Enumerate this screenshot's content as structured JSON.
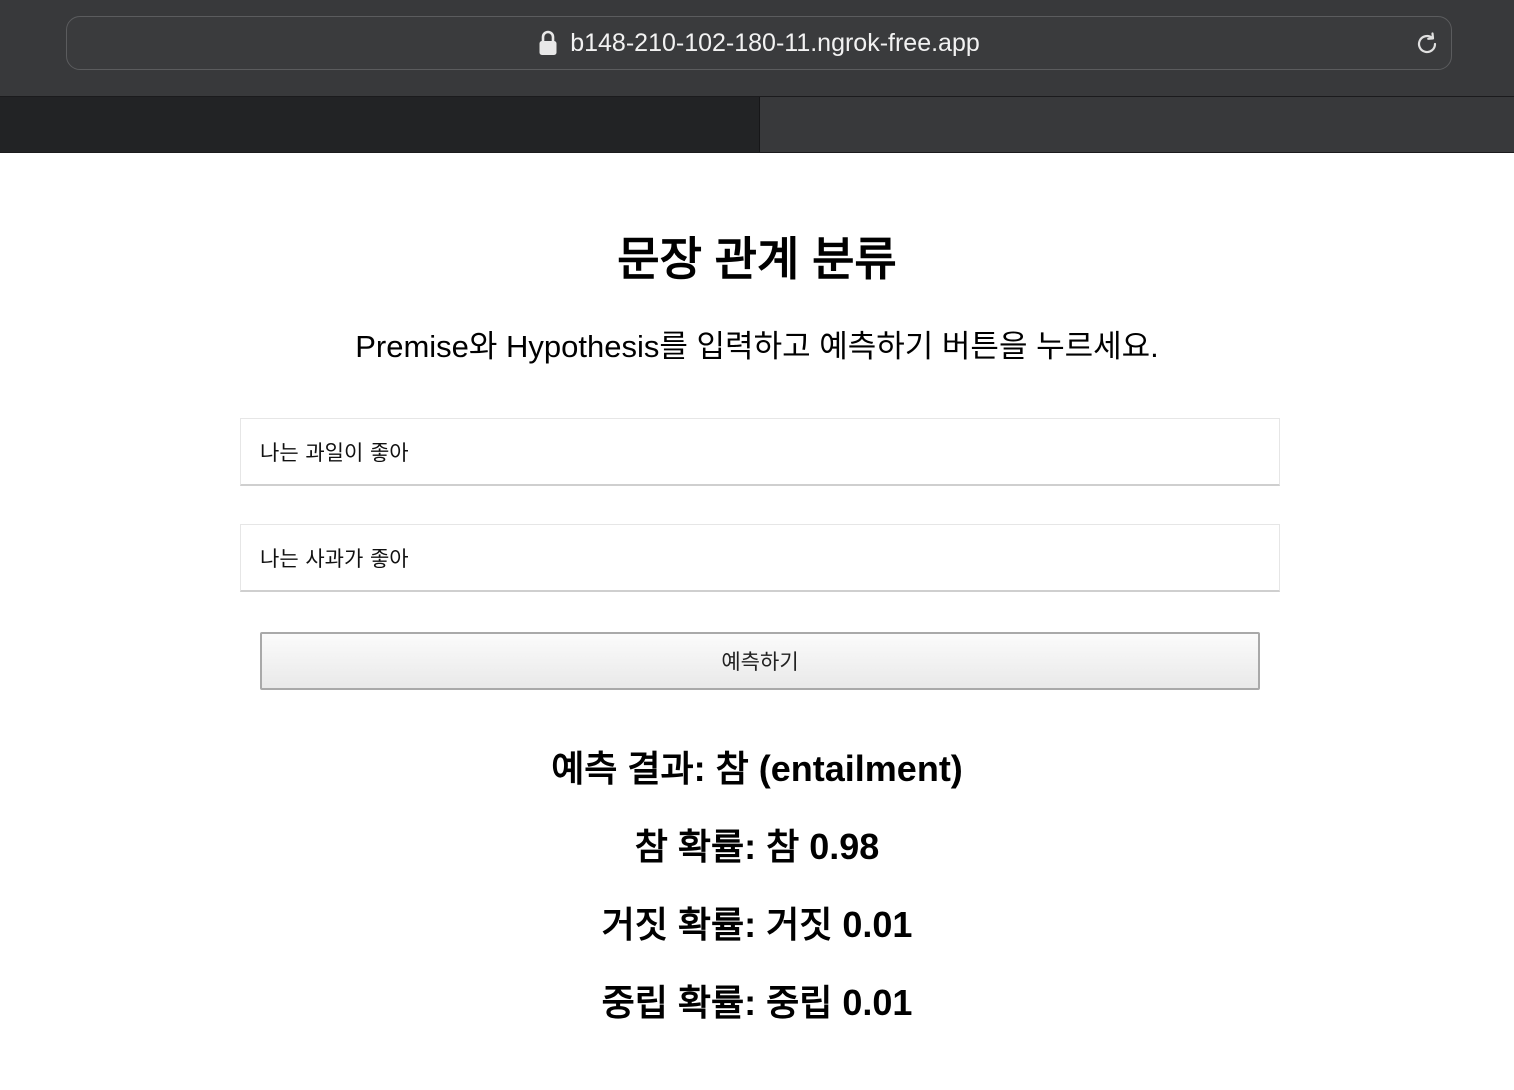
{
  "browser": {
    "url": "b148-210-102-180-11.ngrok-free.app"
  },
  "page": {
    "title": "문장 관계 분류",
    "subtitle": "Premise와 Hypothesis를 입력하고 예측하기 버튼을 누르세요.",
    "premise_value": "나는 과일이 좋아",
    "hypothesis_value": "나는 사과가 좋아",
    "predict_button_label": "예측하기"
  },
  "results": {
    "prediction": "예측 결과: 참 (entailment)",
    "prob_true": "참 확률: 참 0.98",
    "prob_false": "거짓 확률: 거짓 0.01",
    "prob_neutral": "중립 확률: 중립 0.01"
  }
}
